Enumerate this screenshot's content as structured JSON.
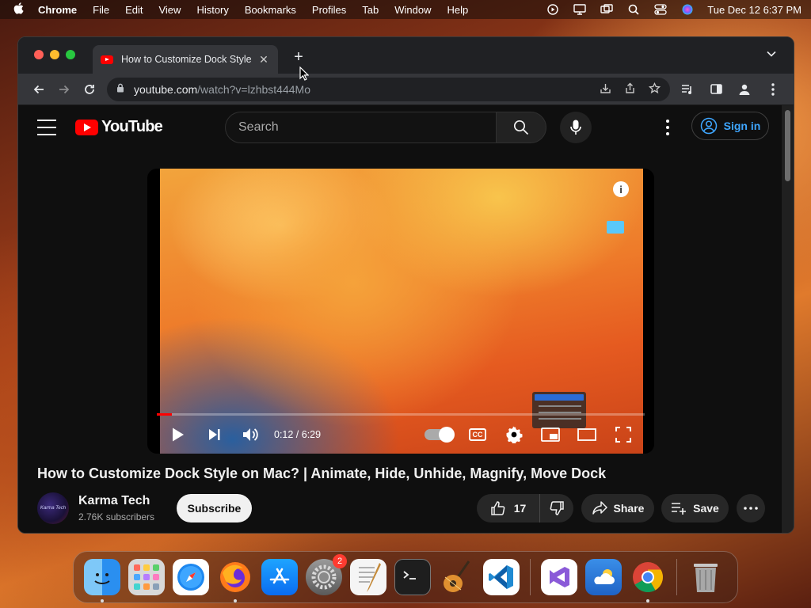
{
  "menubar": {
    "app_name": "Chrome",
    "menus": [
      "File",
      "Edit",
      "View",
      "History",
      "Bookmarks",
      "Profiles",
      "Tab",
      "Window",
      "Help"
    ],
    "datetime": "Tue Dec 12  6:37 PM"
  },
  "browser": {
    "tab_title": "How to Customize Dock Style",
    "url_host": "youtube.com",
    "url_path": "/watch?v=lzhbst444Mo"
  },
  "youtube": {
    "logo_text": "YouTube",
    "search_placeholder": "Search",
    "sign_in_label": "Sign in",
    "player": {
      "time_display": "0:12 / 6:29",
      "progress_fraction": 0.031,
      "cc_label": "CC"
    },
    "video_title": "How to Customize Dock Style on Mac? | Animate, Hide, Unhide, Magnify, Move Dock",
    "channel": {
      "avatar_text": "Karma Tech",
      "name": "Karma Tech",
      "subscribers": "2.76K subscribers"
    },
    "subscribe_label": "Subscribe",
    "like_count": "17",
    "share_label": "Share",
    "save_label": "Save"
  },
  "dock": {
    "apps": [
      {
        "name": "finder",
        "running": true
      },
      {
        "name": "launchpad",
        "running": false
      },
      {
        "name": "safari",
        "running": false
      },
      {
        "name": "firefox",
        "running": true
      },
      {
        "name": "app-store",
        "running": false
      },
      {
        "name": "system-preferences",
        "running": false,
        "badge": "2"
      },
      {
        "name": "textedit",
        "running": false
      },
      {
        "name": "terminal",
        "running": false
      },
      {
        "name": "garageband",
        "running": false
      },
      {
        "name": "vscode",
        "running": false
      },
      {
        "name": "visual-studio",
        "running": false
      },
      {
        "name": "weather",
        "running": false
      },
      {
        "name": "chrome",
        "running": true
      },
      {
        "name": "trash",
        "running": false
      }
    ]
  },
  "colors": {
    "youtube_red": "#ff0000",
    "sign_in_blue": "#3ea6ff",
    "page_background": "#0f0f0f"
  }
}
